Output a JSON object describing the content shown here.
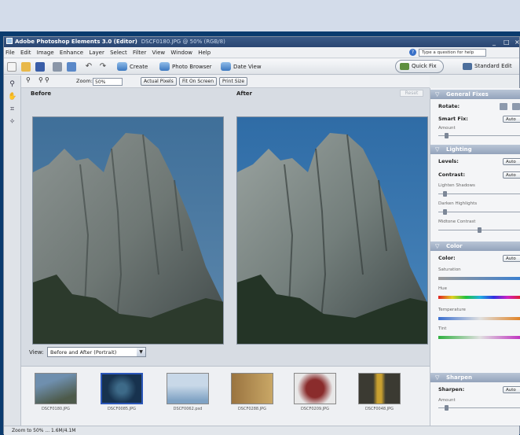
{
  "app": {
    "title": "Adobe Photoshop Elements 3.0 (Editor)",
    "document": "DSCF0180.JPG @ 50% (RGB/8)",
    "window_controls": [
      "_",
      "□",
      "×"
    ]
  },
  "menu": [
    "File",
    "Edit",
    "Image",
    "Enhance",
    "Layer",
    "Select",
    "Filter",
    "View",
    "Window",
    "Help"
  ],
  "help_placeholder": "Type a question for help",
  "toolbar": {
    "create": "Create",
    "photo_browser": "Photo Browser",
    "date_view": "Date View",
    "quick_fix": "Quick Fix",
    "standard_edit": "Standard Edit"
  },
  "options": {
    "zoom_label": "Zoom:",
    "zoom_value": "50%",
    "actual_pixels": "Actual Pixels",
    "fit_on_screen": "Fit On Screen",
    "print_size": "Print Size"
  },
  "panes": {
    "before": "Before",
    "after": "After",
    "reset": "Reset"
  },
  "view": {
    "label": "View:",
    "value": "Before and After (Portrait)"
  },
  "filmstrip": [
    {
      "name": "DSCF0180.JPG",
      "colors": [
        "#6f8fae",
        "#4d5a4a"
      ]
    },
    {
      "name": "DSCF0085.JPG",
      "colors": [
        "#17324e",
        "#3d6a88"
      ]
    },
    {
      "name": "DSCF0062.psd",
      "colors": [
        "#c8d8e8",
        "#7fa2c4"
      ]
    },
    {
      "name": "DSCF0288.JPG",
      "colors": [
        "#9a7440",
        "#c9a766"
      ]
    },
    {
      "name": "DSCF0209.JPG",
      "colors": [
        "#e8e8e8",
        "#8a2c2c"
      ]
    },
    {
      "name": "DSCF0048.JPG",
      "colors": [
        "#3b3a32",
        "#c8a030"
      ]
    }
  ],
  "status": "Zoom to 50% ... 1.6M/4.1M",
  "quickfix": {
    "general_fixes": "General Fixes",
    "rotate": "Rotate:",
    "smart_fix": "Smart Fix:",
    "amount": "Amount",
    "lighting": "Lighting",
    "levels": "Levels:",
    "contrast": "Contrast:",
    "lighten_shadows": "Lighten Shadows",
    "darken_highlights": "Darken Highlights",
    "midtone_contrast": "Midtone Contrast",
    "color": "Color",
    "color_label": "Color:",
    "saturation": "Saturation",
    "hue": "Hue",
    "temperature": "Temperature",
    "tint": "Tint",
    "sharpen": "Sharpen",
    "sharpen_label": "Sharpen:",
    "sharpen_amount": "Amount",
    "auto": "Auto"
  }
}
